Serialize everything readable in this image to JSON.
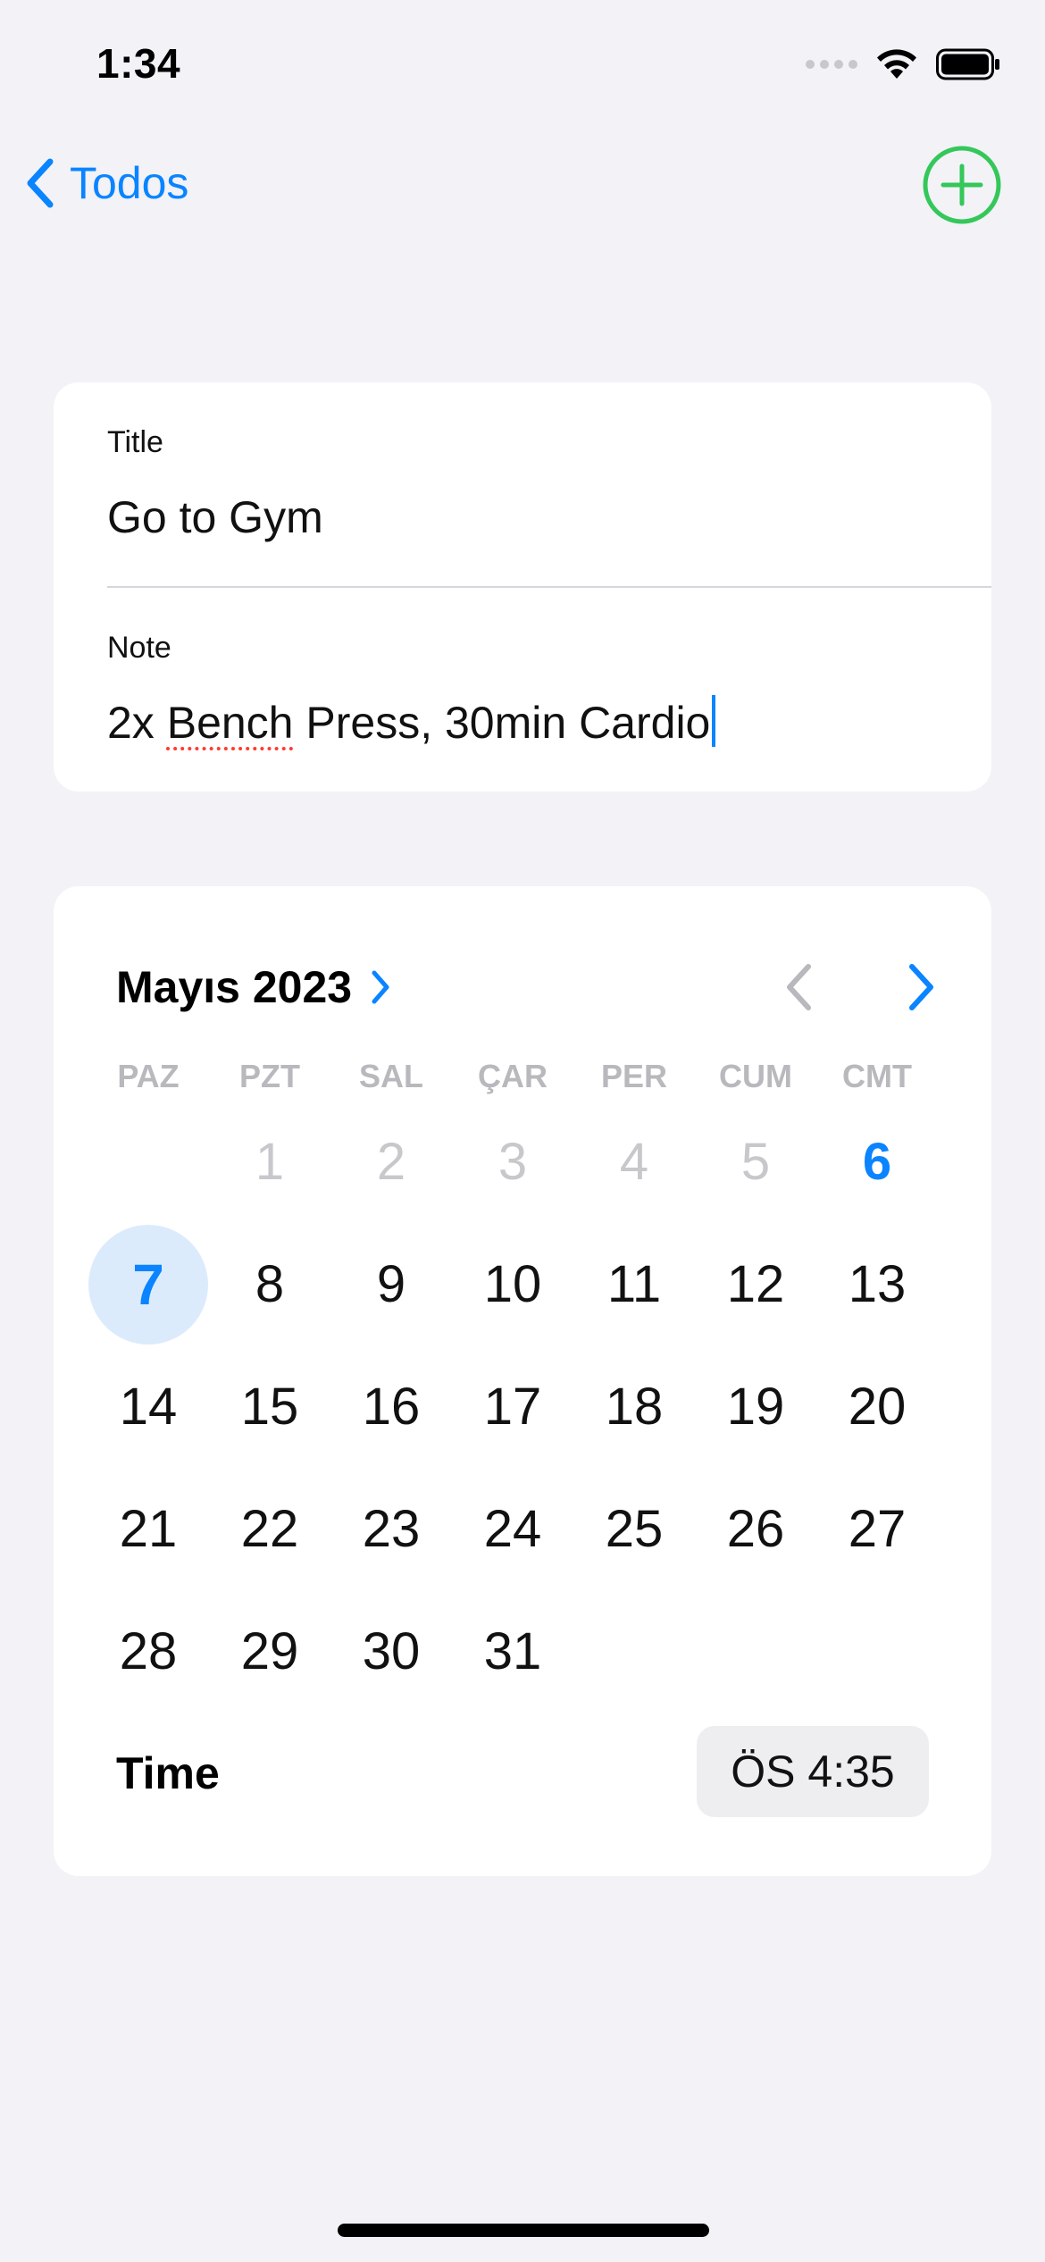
{
  "status_bar": {
    "time": "1:34",
    "icons": [
      "signal-icon",
      "wifi-icon",
      "battery-icon"
    ]
  },
  "nav": {
    "back_label": "Todos",
    "add_icon": "plus-circle-icon",
    "accent": "#0a84ff",
    "add_color": "#34c759"
  },
  "form": {
    "title_label": "Title",
    "title_value": "Go to Gym",
    "note_label": "Note",
    "note_value_word1": "2x",
    "note_value_misspelled": "Bench",
    "note_value_rest": "Press, 30min Cardio"
  },
  "calendar": {
    "month_label": "Mayıs 2023",
    "weekdays": [
      "PAZ",
      "PZT",
      "SAL",
      "ÇAR",
      "PER",
      "CUM",
      "CMT"
    ],
    "days": [
      {
        "label": "",
        "state": "empty"
      },
      {
        "label": "1",
        "state": "muted"
      },
      {
        "label": "2",
        "state": "muted"
      },
      {
        "label": "3",
        "state": "muted"
      },
      {
        "label": "4",
        "state": "muted"
      },
      {
        "label": "5",
        "state": "muted"
      },
      {
        "label": "6",
        "state": "today"
      },
      {
        "label": "7",
        "state": "selected"
      },
      {
        "label": "8",
        "state": "normal"
      },
      {
        "label": "9",
        "state": "normal"
      },
      {
        "label": "10",
        "state": "normal"
      },
      {
        "label": "11",
        "state": "normal"
      },
      {
        "label": "12",
        "state": "normal"
      },
      {
        "label": "13",
        "state": "normal"
      },
      {
        "label": "14",
        "state": "normal"
      },
      {
        "label": "15",
        "state": "normal"
      },
      {
        "label": "16",
        "state": "normal"
      },
      {
        "label": "17",
        "state": "normal"
      },
      {
        "label": "18",
        "state": "normal"
      },
      {
        "label": "19",
        "state": "normal"
      },
      {
        "label": "20",
        "state": "normal"
      },
      {
        "label": "21",
        "state": "normal"
      },
      {
        "label": "22",
        "state": "normal"
      },
      {
        "label": "23",
        "state": "normal"
      },
      {
        "label": "24",
        "state": "normal"
      },
      {
        "label": "25",
        "state": "normal"
      },
      {
        "label": "26",
        "state": "normal"
      },
      {
        "label": "27",
        "state": "normal"
      },
      {
        "label": "28",
        "state": "normal"
      },
      {
        "label": "29",
        "state": "normal"
      },
      {
        "label": "30",
        "state": "normal"
      },
      {
        "label": "31",
        "state": "normal"
      }
    ],
    "time_label": "Time",
    "time_value": "ÖS 4:35"
  }
}
